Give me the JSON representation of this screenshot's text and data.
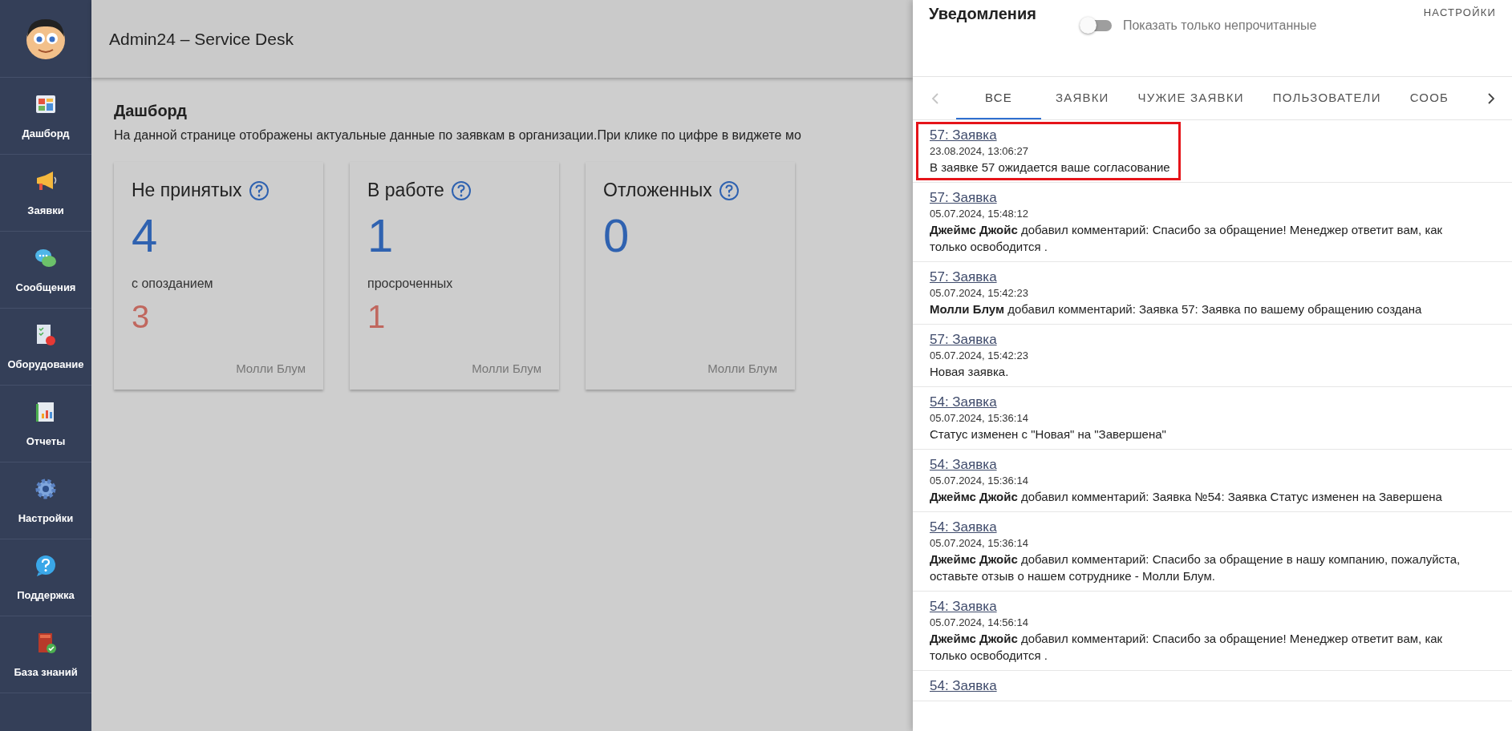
{
  "sidebar": {
    "items": [
      {
        "label": "Дашборд"
      },
      {
        "label": "Заявки"
      },
      {
        "label": "Сообщения"
      },
      {
        "label": "Оборудование"
      },
      {
        "label": "Отчеты"
      },
      {
        "label": "Настройки"
      },
      {
        "label": "Поддержка"
      },
      {
        "label": "База знаний"
      }
    ]
  },
  "header": {
    "title": "Admin24 – Service Desk"
  },
  "dashboard": {
    "title": "Дашборд",
    "description": "На данной странице отображены актуальные данные по заявкам в организации.При клике по цифре в виджете мо",
    "cards": [
      {
        "title": "Не принятых",
        "count": "4",
        "sub_label": "с опозданием",
        "sub_count": "3",
        "owner": "Молли Блум"
      },
      {
        "title": "В работе",
        "count": "1",
        "sub_label": "просроченных",
        "sub_count": "1",
        "owner": "Молли Блум"
      },
      {
        "title": "Отложенных",
        "count": "0",
        "owner": "Молли Блум"
      }
    ]
  },
  "notifications": {
    "title": "Уведомления",
    "settings": "НАСТРОЙКИ",
    "unread_toggle": {
      "label": "Показать только непрочитанные",
      "on": false
    },
    "tabs": [
      {
        "label": "ВСЕ",
        "selected": true
      },
      {
        "label": "ЗАЯВКИ",
        "selected": false
      },
      {
        "label": "ЧУЖИЕ ЗАЯВКИ",
        "selected": false
      },
      {
        "label": "ПОЛЬЗОВАТЕЛИ",
        "selected": false
      },
      {
        "label": "СООБ",
        "selected": false
      }
    ],
    "items": [
      {
        "link": "57: Заявка",
        "date": "23.08.2024, 13:06:27",
        "text": "В заявке 57 ожидается ваше согласование",
        "highlighted": true
      },
      {
        "link": "57: Заявка",
        "date": "05.07.2024, 15:48:12",
        "text": "**Джеймс Джойс** добавил комментарий: Спасибо за обращение! Менеджер ответит вам, как только освободится .",
        "highlighted": false
      },
      {
        "link": "57: Заявка",
        "date": "05.07.2024, 15:42:23",
        "text": "**Молли Блум** добавил комментарий: Заявка 57: Заявка по вашему обращению создана",
        "highlighted": false
      },
      {
        "link": "57: Заявка",
        "date": "05.07.2024, 15:42:23",
        "text": "Новая заявка.",
        "highlighted": false
      },
      {
        "link": "54: Заявка",
        "date": "05.07.2024, 15:36:14",
        "text": "Статус изменен с \"Новая\" на \"Завершена\"",
        "highlighted": false
      },
      {
        "link": "54: Заявка",
        "date": "05.07.2024, 15:36:14",
        "text": "**Джеймс Джойс** добавил комментарий: Заявка №54: Заявка Статус изменен на Завершена",
        "highlighted": false
      },
      {
        "link": "54: Заявка",
        "date": "05.07.2024, 15:36:14",
        "text": "**Джеймс Джойс** добавил комментарий: Спасибо за обращение в нашу компанию, пожалуйста, оставьте отзыв о нашем сотруднике - Молли Блум.",
        "highlighted": false
      },
      {
        "link": "54: Заявка",
        "date": "05.07.2024, 14:56:14",
        "text": "**Джеймс Джойс** добавил комментарий: Спасибо за обращение! Менеджер ответит вам, как только освободится .",
        "highlighted": false
      },
      {
        "link": "54: Заявка",
        "highlighted": false
      }
    ]
  }
}
